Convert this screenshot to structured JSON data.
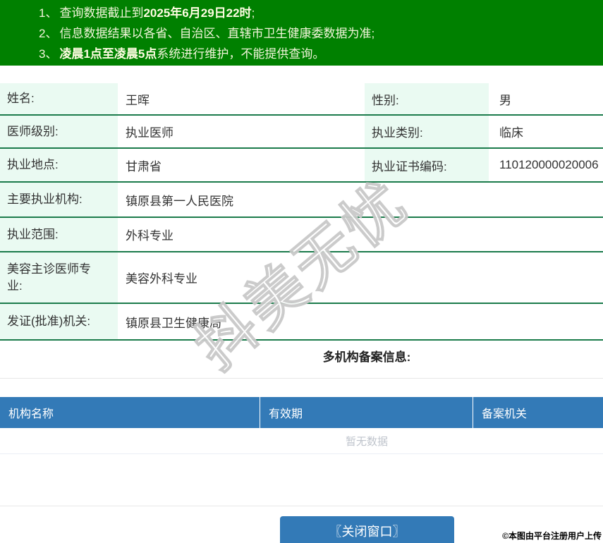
{
  "colors": {
    "banner_green": "#008000",
    "table_border_green": "#1B7B4B",
    "label_bg_mint": "#EAFAF2",
    "header_blue": "#337AB7",
    "button_blue": "#337AB7",
    "empty_text_gray": "#BFC4CC",
    "banner_text": "#F2F5DA"
  },
  "banner": {
    "notes": [
      {
        "num": "1、",
        "pre": "查询数据截止到",
        "bold": "2025年6月29日22时",
        "post": ";"
      },
      {
        "num": "2、",
        "pre": "信息数据结果以各省、自治区、直辖市卫生健康委数据为准;",
        "bold": "",
        "post": ""
      },
      {
        "num": "3、",
        "pre": "",
        "bold": "凌晨1点至凌晨5点",
        "post": "系统进行维护，不能提供查询。"
      }
    ]
  },
  "profile": {
    "rows": [
      {
        "label1": "姓名:",
        "value1": "王晖",
        "label2": "性别:",
        "value2": "男"
      },
      {
        "label1": "医师级别:",
        "value1": "执业医师",
        "label2": "执业类别:",
        "value2": "临床"
      },
      {
        "label1": "执业地点:",
        "value1": "甘肃省",
        "label2": "执业证书编码:",
        "value2": "110120000020006"
      },
      {
        "label": "主要执业机构:",
        "value": "镇原县第一人民医院"
      },
      {
        "label": "执业范围:",
        "value": "外科专业"
      },
      {
        "label": "美容主诊医师专业:",
        "value": "美容外科专业"
      },
      {
        "label": "发证(批准)机关:",
        "value": "镇原县卫生健康局"
      }
    ]
  },
  "multi_org": {
    "title": "多机构备案信息:",
    "columns": [
      "机构名称",
      "有效期",
      "备案机关"
    ],
    "empty_text": "暂无数据"
  },
  "footer": {
    "close_button": "〖关闭窗口〗",
    "copyright": "©本图由平台注册用户上传"
  },
  "watermark": {
    "text": "抖美无忧"
  }
}
